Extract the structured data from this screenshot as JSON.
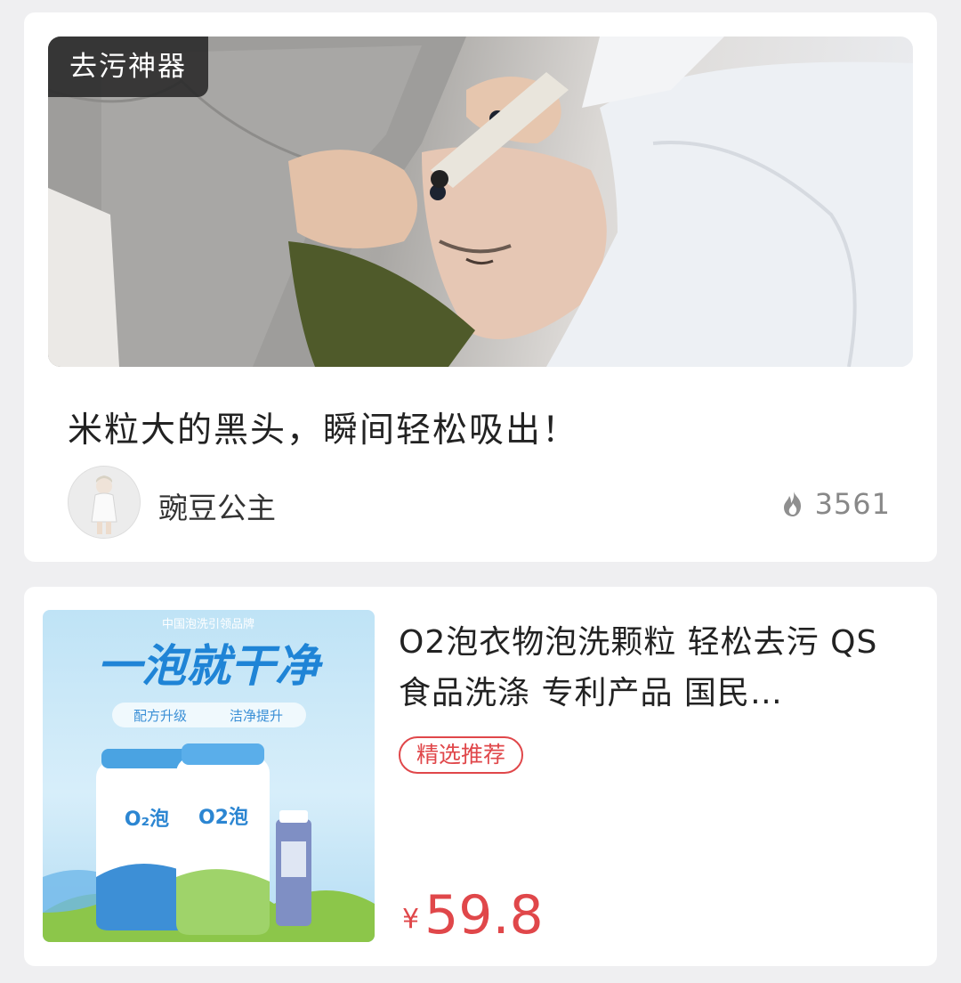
{
  "article": {
    "tag": "去污神器",
    "title": "米粒大的黑头，瞬间轻松吸出！",
    "author": "豌豆公主",
    "views": "3561",
    "icons": {
      "views": "flame-icon"
    }
  },
  "product": {
    "image_texts": {
      "brand_line": "中国泡洗引领品牌",
      "slogan": "一泡就干净",
      "sub_left": "配方升级",
      "sub_right": "洁净提升",
      "pkg_logo": "O2泡"
    },
    "title": "O2泡衣物泡洗颗粒 轻松去污 QS食品洗涤 专利产品 国民…",
    "badge": "精选推荐",
    "currency": "¥",
    "price": "59.8"
  },
  "colors": {
    "accent_red": "#e0474a",
    "background": "#efeff1",
    "card": "#ffffff"
  }
}
